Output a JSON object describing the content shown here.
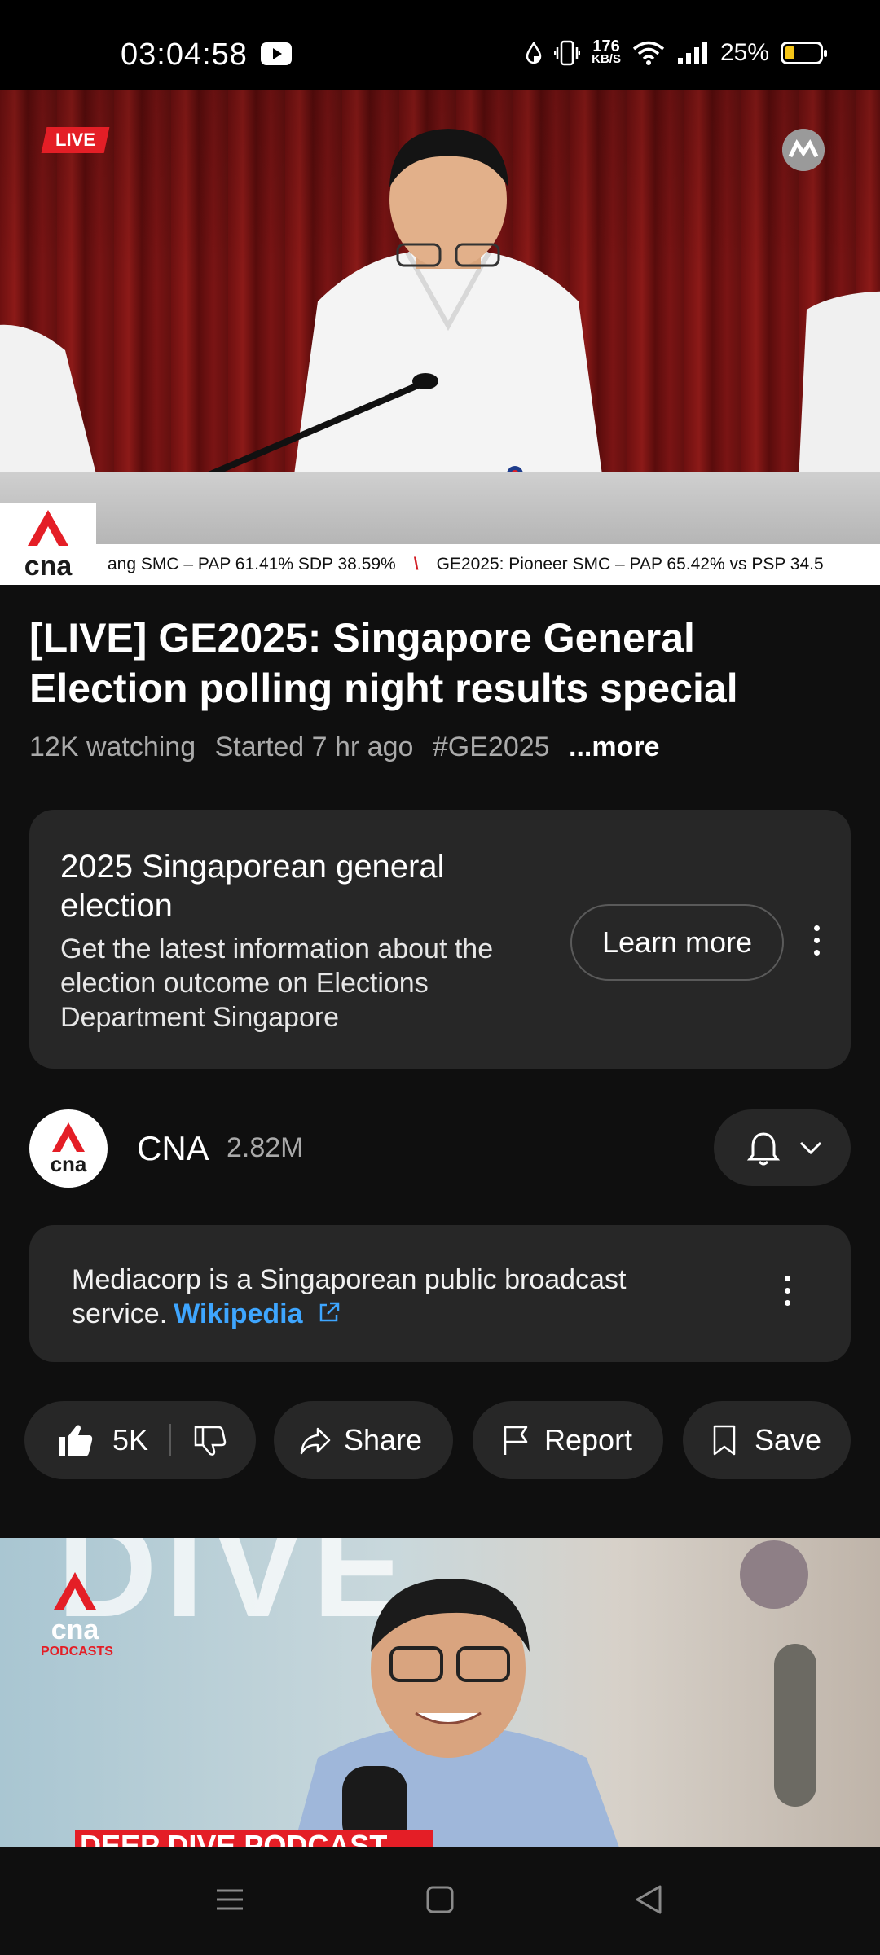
{
  "status_bar": {
    "time": "03:04:58",
    "net_speed_value": "176",
    "net_speed_unit": "KB/S",
    "battery_percent": "25%",
    "battery_color": "#f5c518"
  },
  "player": {
    "live_label": "LIVE",
    "channel_watermark": "cna",
    "ticker_items": [
      "ang SMC – PAP 61.41% SDP 38.59%",
      "GE2025: Pioneer SMC – PAP 65.42% vs PSP 34.5"
    ],
    "ticker_separator": "\\"
  },
  "video": {
    "title": "[LIVE] GE2025: Singapore General Election polling night results special",
    "watching": "12K watching",
    "started": "Started 7 hr ago",
    "hashtag": "#GE2025",
    "more_label": "...more"
  },
  "info_card": {
    "heading": "2025 Singaporean general election",
    "body": "Get the latest information about the election outcome on Elections Department Singapore",
    "button_label": "Learn more"
  },
  "channel": {
    "name": "CNA",
    "subscribers": "2.82M",
    "avatar_text": "cna"
  },
  "wiki_card": {
    "text": "Mediacorp is a Singaporean public broadcast service.",
    "link_label": "Wikipedia"
  },
  "actions": {
    "like_count": "5K",
    "share_label": "Share",
    "report_label": "Report",
    "save_label": "Save"
  },
  "next_video": {
    "bg_word": "DIVE",
    "logo_text": "cna",
    "logo_sub": "PODCASTS",
    "banner_text": "DEEP DIVE PODCAST"
  },
  "colors": {
    "accent_red": "#e41e26",
    "link_blue": "#3ea6ff",
    "card_bg": "#272727",
    "page_bg": "#0f0f0f"
  }
}
